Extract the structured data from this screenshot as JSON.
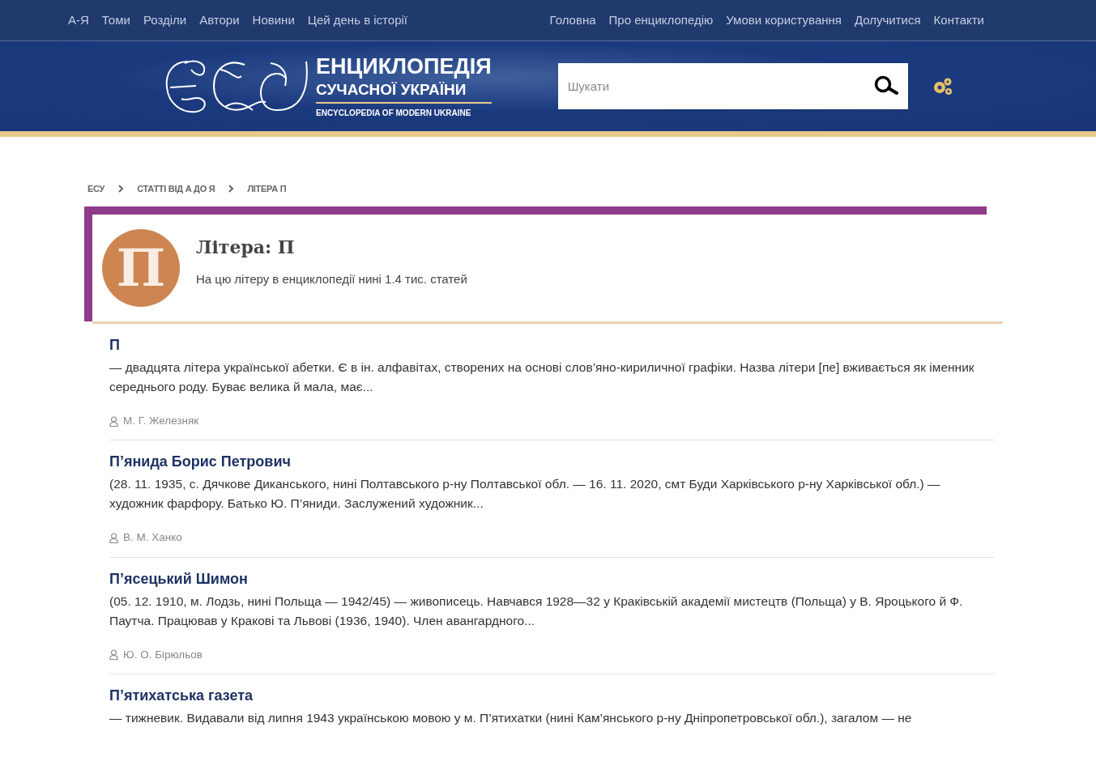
{
  "top_nav_left": [
    "А-Я",
    "Томи",
    "Розділи",
    "Автори",
    "Новини",
    "Цей день в історії"
  ],
  "top_nav_right": [
    "Головна",
    "Про енциклопедію",
    "Умови користування",
    "Долучитися",
    "Контакти"
  ],
  "logo": {
    "title": "ЕНЦИКЛОПЕДІЯ",
    "subtitle": "СУЧАСНОЇ УКРАЇНИ",
    "english": "ENCYCLOPEDIA OF MODERN UKRAINE"
  },
  "search": {
    "placeholder": "Шукати"
  },
  "breadcrumbs": [
    "ЕСУ",
    "СТАТТІ ВІД А ДО Я",
    "ЛІТЕРА П"
  ],
  "letter_card": {
    "letter": "П",
    "title": "Літера: П",
    "description": "На цю літеру в енциклопедії нині 1.4 тис. статей"
  },
  "articles": [
    {
      "title": "П",
      "summary": "— двадцята літера української абетки. Є в ін. алфавітах, створених на основі слов’яно-кириличної графіки. Назва літери [пе] вживається як іменник середнього роду. Буває велика й мала, має...",
      "author": "М. Г. Железняк"
    },
    {
      "title": "П’янида Борис Петрович",
      "summary": "(28. 11. 1935, с. Дячкове Диканського, нині Полтавського р-ну Полтавської обл. — 16. 11. 2020, смт Буди Харківського р-ну Харківської обл.) — художник фарфору. Батько Ю. П’яниди. Заслужений художник...",
      "author": "В. М. Ханко"
    },
    {
      "title": "П’ясецький Шимон",
      "summary": "(05. 12. 1910, м. Лодзь, нині Польща — 1942/45) — живописець. Навчався 1928—32 у Краківській академії мистецтв (Польща) у В. Яроцького й Ф. Паутча. Працював у Кракові та Львові (1936, 1940). Член авангардного...",
      "author": "Ю. О. Бірюльов"
    },
    {
      "title": "П’ятихатська газета",
      "summary": "— тижневик. Видавали від липня 1943 українською мовою у м. П’ятихатки (нині Кам’янського р-ну Дніпропетровської обл.), загалом — не"
    }
  ]
}
